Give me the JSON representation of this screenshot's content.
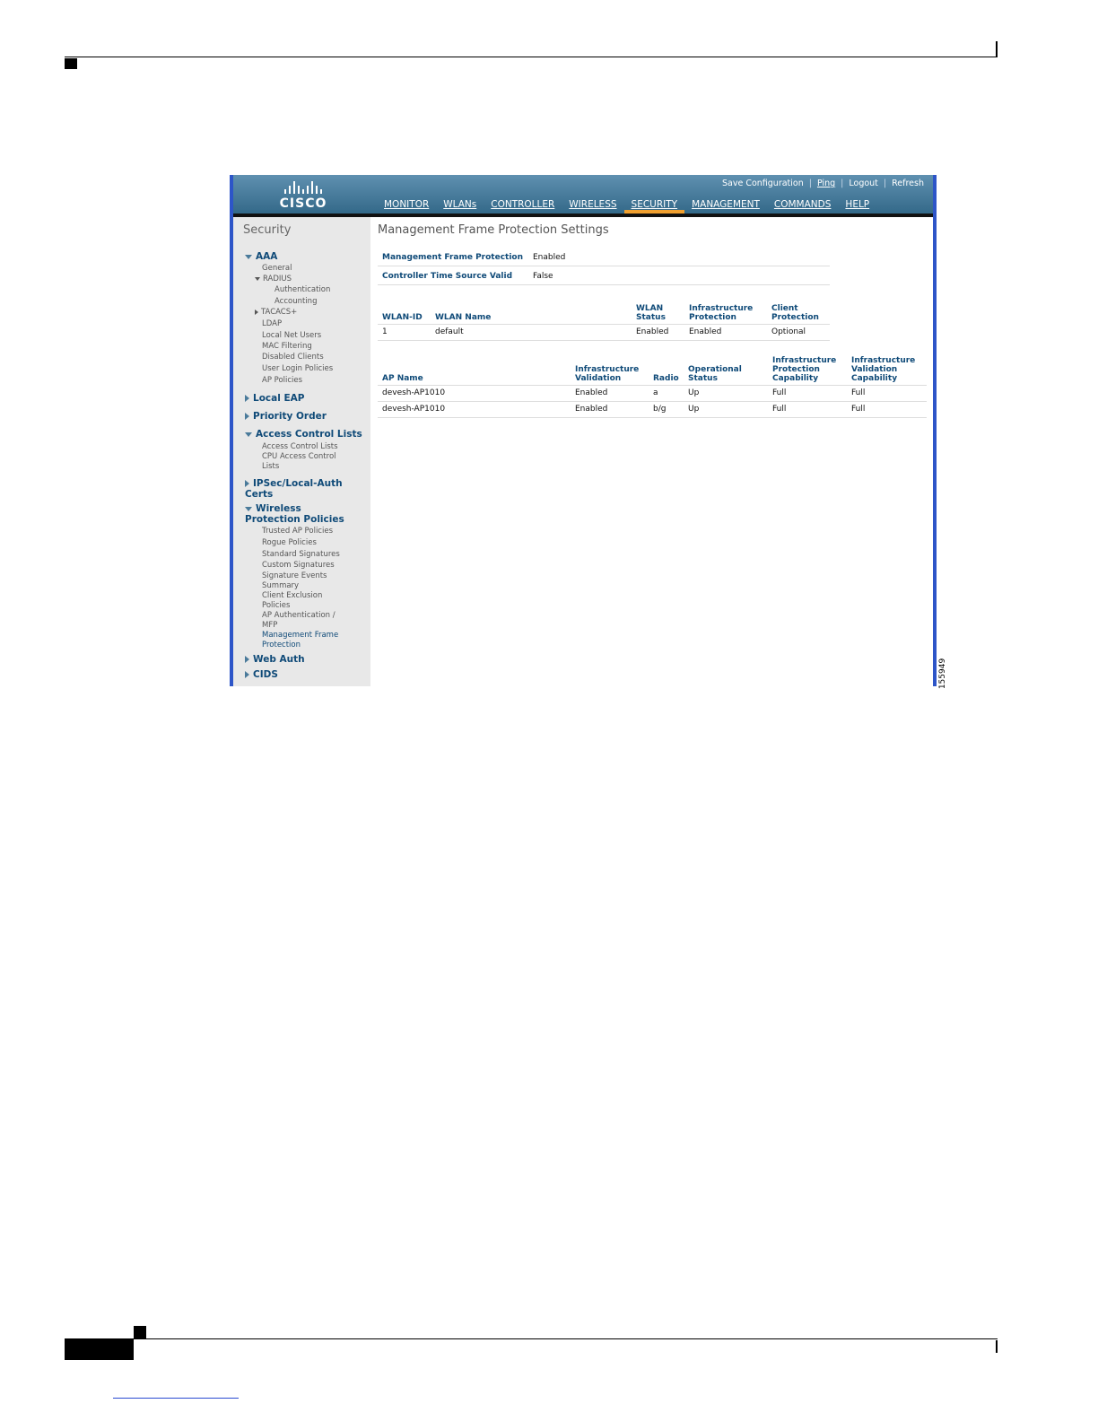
{
  "figure": {
    "id": "155949"
  },
  "topbar": {
    "logo_text": "CISCO",
    "links": [
      "Save Configuration",
      "Ping",
      "Logout",
      "Refresh"
    ],
    "nav": [
      "MONITOR",
      "WLANs",
      "CONTROLLER",
      "WIRELESS",
      "SECURITY",
      "MANAGEMENT",
      "COMMANDS",
      "HELP"
    ],
    "active_nav": "SECURITY"
  },
  "sidebar": {
    "title": "Security",
    "aaa": {
      "label": "AAA",
      "items": [
        "General",
        "RADIUS",
        "Authentication",
        "Accounting",
        "TACACS+",
        "LDAP",
        "Local Net Users",
        "MAC Filtering",
        "Disabled Clients",
        "User Login Policies",
        "AP Policies"
      ]
    },
    "local_eap": "Local EAP",
    "priority_order": "Priority Order",
    "acl": {
      "label": "Access Control Lists",
      "items": [
        "Access Control Lists",
        "CPU Access Control Lists"
      ]
    },
    "ipsec": "IPSec/Local-Auth Certs",
    "wpp": {
      "label": "Wireless Protection Policies",
      "items": [
        "Trusted AP Policies",
        "Rogue Policies",
        "Standard Signatures",
        "Custom Signatures",
        "Signature Events Summary",
        "Client Exclusion Policies",
        "AP Authentication / MFP",
        "Management Frame Protection"
      ]
    },
    "web_auth": "Web Auth",
    "cids": "CIDS"
  },
  "main": {
    "title": "Management Frame Protection Settings",
    "settings": [
      {
        "label": "Management Frame Protection",
        "value": "Enabled"
      },
      {
        "label": "Controller Time Source Valid",
        "value": "False"
      }
    ],
    "wlan_table": {
      "headers": [
        "WLAN-ID",
        "WLAN Name",
        "WLAN Status",
        "Infrastructure Protection",
        "Client Protection"
      ],
      "rows": [
        [
          "1",
          "default",
          "Enabled",
          "Enabled",
          "Optional"
        ]
      ]
    },
    "ap_table": {
      "headers": [
        "AP Name",
        "Infrastructure Validation",
        "Radio",
        "Operational Status",
        "Infrastructure Protection Capability",
        "Infrastructure Validation Capability"
      ],
      "rows": [
        [
          "devesh-AP1010",
          "Enabled",
          "a",
          "Up",
          "Full",
          "Full"
        ],
        [
          "devesh-AP1010",
          "Enabled",
          "b/g",
          "Up",
          "Full",
          "Full"
        ]
      ]
    }
  }
}
